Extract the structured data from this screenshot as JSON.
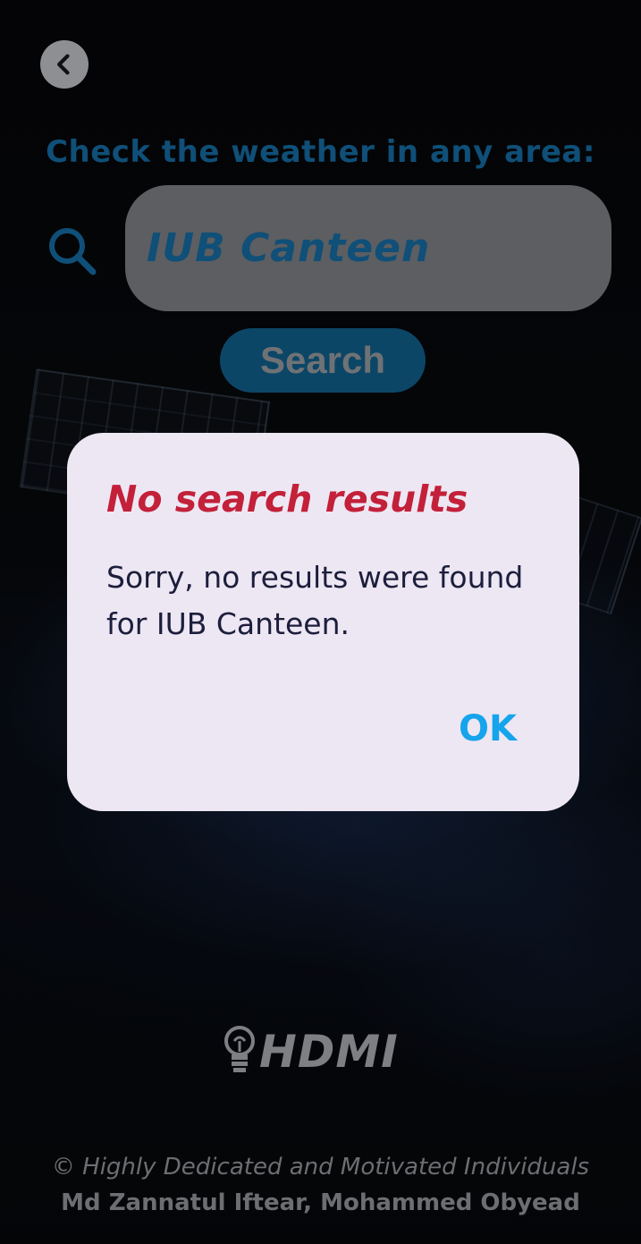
{
  "header": {
    "back_icon": "chevron-left-icon",
    "headline": "Check the weather in any area:"
  },
  "search": {
    "icon": "search-icon",
    "value": "IUB Canteen",
    "button_label": "Search"
  },
  "dialog": {
    "title": "No search results",
    "message": "Sorry, no results were found for IUB Canteen.",
    "ok_label": "OK"
  },
  "branding": {
    "logo_icon": "lightbulb-icon",
    "logo_text": "HDMI"
  },
  "footer": {
    "line1": "© Highly Dedicated and Motivated Individuals",
    "line2": "Md Zannatul Iftear, Mohammed Obyead"
  },
  "colors": {
    "accent_blue": "#0f4f78",
    "dialog_title_red": "#c3203a",
    "ok_blue": "#16a4ec",
    "dialog_bg": "#ede7f3"
  }
}
